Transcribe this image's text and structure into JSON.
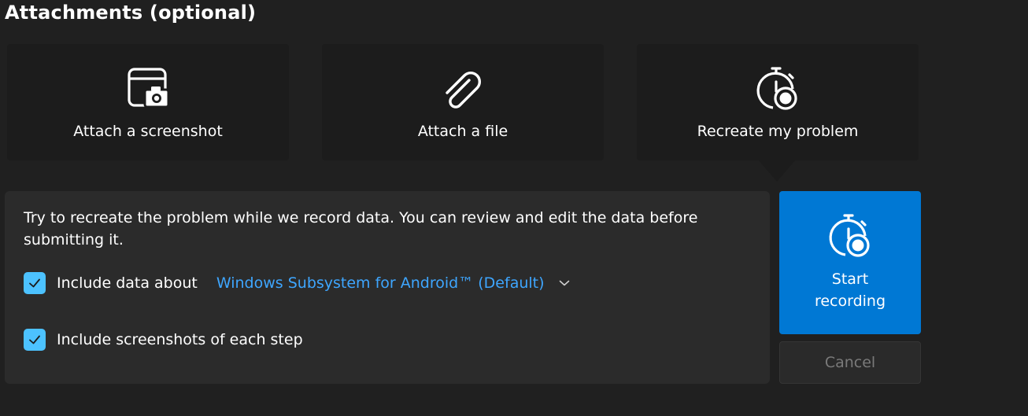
{
  "section": {
    "title": "Attachments (optional)"
  },
  "tiles": [
    {
      "label": "Attach a screenshot",
      "icon": "screenshot-camera-icon"
    },
    {
      "label": "Attach a file",
      "icon": "paperclip-icon"
    },
    {
      "label": "Recreate my problem",
      "icon": "stopwatch-record-icon"
    }
  ],
  "panel": {
    "description": "Try to recreate the problem while we record data. You can review and edit the data before submitting it.",
    "include_data": {
      "label": "Include data about",
      "checked": true,
      "selected_value": "Windows Subsystem for Android™ (Default)"
    },
    "include_screenshots": {
      "label": "Include screenshots of each step",
      "checked": true
    }
  },
  "actions": {
    "start_label": "Start recording",
    "cancel_label": "Cancel"
  },
  "colors": {
    "background": "#202020",
    "tile": "#1c1c1c",
    "panel": "#2b2b2b",
    "accent": "#0078d4",
    "checkbox": "#4cc2ff",
    "link": "#3ea6ff",
    "disabled_text": "#7a7a7a"
  }
}
